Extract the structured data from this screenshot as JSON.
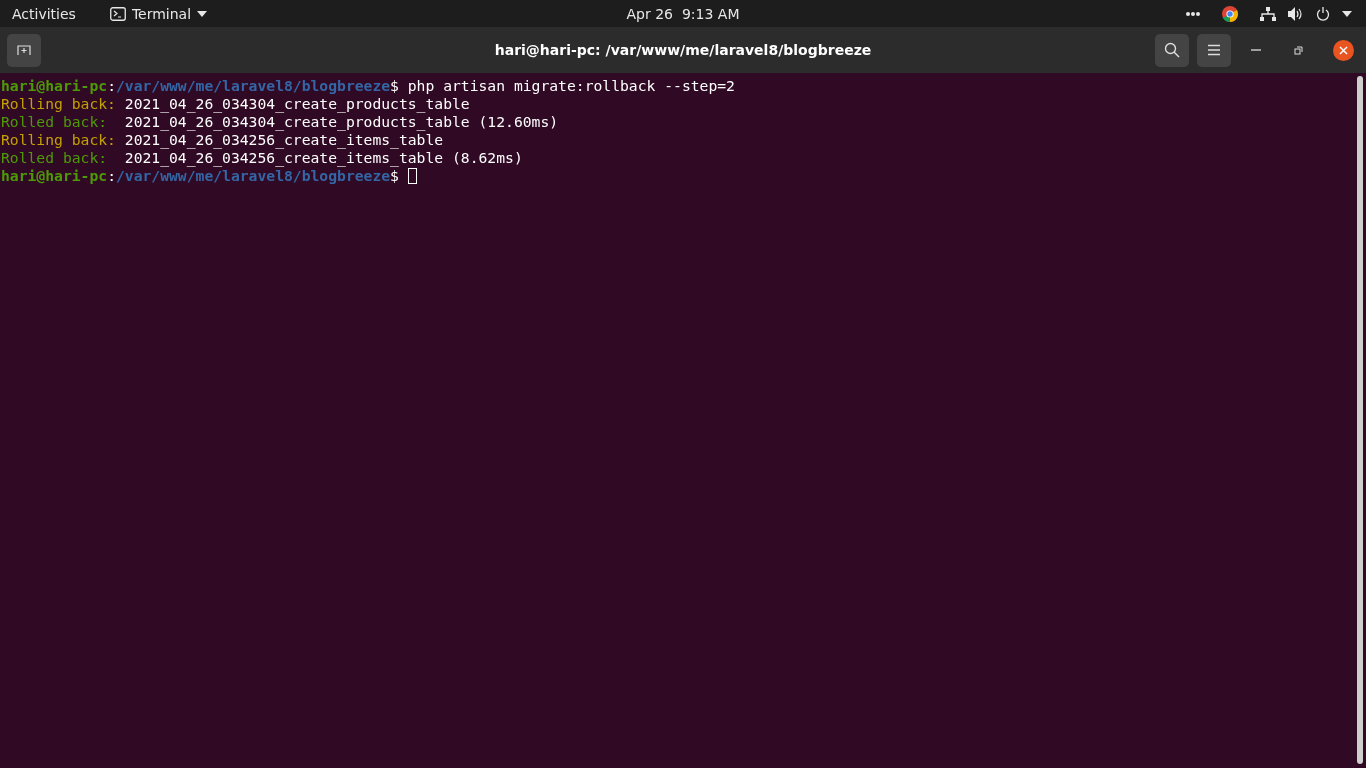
{
  "top_bar": {
    "activities": "Activities",
    "app_menu": "Terminal",
    "clock": "Apr 26  9:13 AM"
  },
  "window": {
    "title": "hari@hari-pc: /var/www/me/laravel8/blogbreeze"
  },
  "terminal": {
    "lines": [
      {
        "segments": [
          {
            "kind": "user",
            "text": "hari@hari-pc"
          },
          {
            "kind": "plain",
            "text": ":"
          },
          {
            "kind": "path",
            "text": "/var/www/me/laravel8/blogbreeze"
          },
          {
            "kind": "plain",
            "text": "$ php artisan migrate:rollback --step=2"
          }
        ]
      },
      {
        "segments": [
          {
            "kind": "rolling",
            "text": "Rolling back:"
          },
          {
            "kind": "plain",
            "text": " 2021_04_26_034304_create_products_table"
          }
        ]
      },
      {
        "segments": [
          {
            "kind": "rolled",
            "text": "Rolled back:"
          },
          {
            "kind": "plain",
            "text": "  2021_04_26_034304_create_products_table (12.60ms)"
          }
        ]
      },
      {
        "segments": [
          {
            "kind": "rolling",
            "text": "Rolling back:"
          },
          {
            "kind": "plain",
            "text": " 2021_04_26_034256_create_items_table"
          }
        ]
      },
      {
        "segments": [
          {
            "kind": "rolled",
            "text": "Rolled back:"
          },
          {
            "kind": "plain",
            "text": "  2021_04_26_034256_create_items_table (8.62ms)"
          }
        ]
      },
      {
        "segments": [
          {
            "kind": "user",
            "text": "hari@hari-pc"
          },
          {
            "kind": "plain",
            "text": ":"
          },
          {
            "kind": "path",
            "text": "/var/www/me/laravel8/blogbreeze"
          },
          {
            "kind": "plain",
            "text": "$ "
          },
          {
            "kind": "cursor"
          }
        ]
      }
    ]
  }
}
